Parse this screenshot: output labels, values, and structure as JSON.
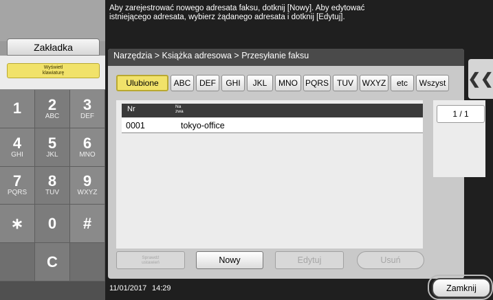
{
  "message": {
    "line1": "Aby zarejestrować nowego adresata faksu, dotknij [Nowy]. Aby edytować",
    "line2": "istniejącego adresata, wybierz żądanego adresata i dotknij [Edytuj]."
  },
  "left_panel": {
    "bookmark_label": "Zakładka",
    "keyboard_label_1": "Wyświetl",
    "keyboard_label_2": "klawiaturę",
    "keypad": [
      {
        "digit": "1",
        "letters": ""
      },
      {
        "digit": "2",
        "letters": "ABC"
      },
      {
        "digit": "3",
        "letters": "DEF"
      },
      {
        "digit": "4",
        "letters": "GHI"
      },
      {
        "digit": "5",
        "letters": "JKL"
      },
      {
        "digit": "6",
        "letters": "MNO"
      },
      {
        "digit": "7",
        "letters": "PQRS"
      },
      {
        "digit": "8",
        "letters": "TUV"
      },
      {
        "digit": "9",
        "letters": "WXYZ"
      },
      {
        "digit": "∗",
        "letters": ""
      },
      {
        "digit": "0",
        "letters": ""
      },
      {
        "digit": "#",
        "letters": ""
      },
      {
        "digit": "",
        "letters": ""
      },
      {
        "digit": "C",
        "letters": ""
      },
      {
        "digit": "",
        "letters": ""
      }
    ]
  },
  "breadcrumb": "Narzędzia > Książka adresowa > Przesyłanie faksu",
  "index_tabs": [
    {
      "label": "Ulubione",
      "selected": true
    },
    {
      "label": "ABC"
    },
    {
      "label": "DEF"
    },
    {
      "label": "GHI"
    },
    {
      "label": "JKL"
    },
    {
      "label": "MNO"
    },
    {
      "label": "PQRS"
    },
    {
      "label": "TUV"
    },
    {
      "label": "WXYZ"
    },
    {
      "label": "etc"
    },
    {
      "label": "Wszyst"
    }
  ],
  "collapse_icon": "double-chevron-left-icon",
  "table": {
    "col_nr": "Nr",
    "col_name_1": "Na",
    "col_name_2": "zwa",
    "rows": [
      {
        "nr": "0001",
        "name": "tokyo-office"
      }
    ]
  },
  "pager": "1 / 1",
  "actions": {
    "check_1": "Sprawdź",
    "check_2": "ustawień",
    "new": "Nowy",
    "edit": "Edytuj",
    "delete": "Usuń"
  },
  "status": {
    "date": "11/01/2017",
    "time": "14:29"
  },
  "close_label": "Zamknij",
  "colors": {
    "selected_tab": "#f1e26a",
    "background": "#1f1f1f",
    "keypad": "#858585"
  }
}
